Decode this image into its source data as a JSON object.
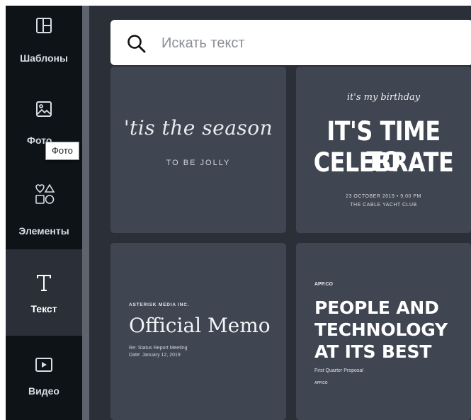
{
  "sidebar": {
    "items": [
      {
        "label": "Шаблоны",
        "icon": "templates-icon"
      },
      {
        "label": "Фото",
        "icon": "photo-icon"
      },
      {
        "label": "Элементы",
        "icon": "elements-icon"
      },
      {
        "label": "Текст",
        "icon": "text-icon"
      },
      {
        "label": "Видео",
        "icon": "video-icon"
      }
    ],
    "active": "Текст"
  },
  "tooltip": {
    "text": "Фото"
  },
  "search": {
    "placeholder": "Искать текст",
    "value": ""
  },
  "cards": {
    "season": {
      "title": "'tis the season",
      "subtitle": "TO BE JOLLY"
    },
    "birthday": {
      "script": "it's my birthday",
      "line1": "IT'S TIME TO",
      "line2": "CELEBRATE",
      "date": "23 OCTOBER 2019 • 9.00 PM",
      "venue": "THE CABLE YACHT CLUB"
    },
    "memo": {
      "kicker": "ASTERISK MEDIA INC.",
      "title": "Official Memo",
      "line1": "Re: Status Report Meeting",
      "line2": "Date: January 12, 2019"
    },
    "people": {
      "brand": "APP.CO",
      "line1": "PEOPLE AND",
      "line2": "TECHNOLOGY",
      "line3": "AT ITS BEST",
      "subtitle": "First Quarter Proposal",
      "footer": "APP.CO"
    }
  },
  "colors": {
    "sidebar": "#0e1318",
    "panel": "#2b3038",
    "card": "#3f4651"
  }
}
